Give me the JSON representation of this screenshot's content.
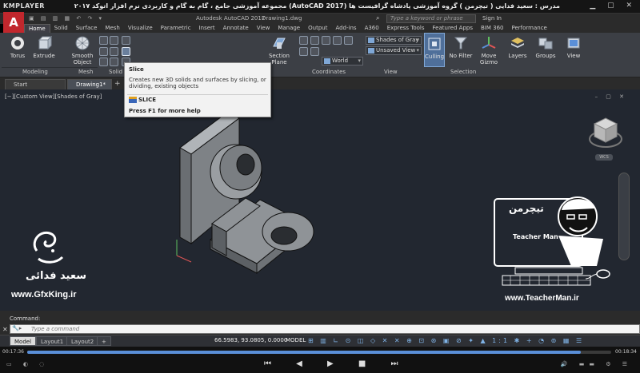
{
  "player": {
    "brand": "KMPLAYER",
    "title": "مجموعه آموزشی جامع ، گام به گام و کاربردی نرم افزار  اتوکد ۲۰۱۷ (AutoCAD 2017)   مدرس : سعید فدایی ( تیچرمن ) گروه آموزشی پادشاه گرافیست ها",
    "time_current": "00:17:36",
    "time_total": "00:18:34",
    "progress": 0.948
  },
  "acad": {
    "logo": "A",
    "app_name": "Autodesk AutoCAD 2017",
    "doc_name": "Drawing1.dwg",
    "search_placeholder": "Type a keyword or phrase",
    "sign_in": "Sign In"
  },
  "ribbon_tabs": [
    "Home",
    "Solid",
    "Surface",
    "Mesh",
    "Visualize",
    "Parametric",
    "Insert",
    "Annotate",
    "View",
    "Manage",
    "Output",
    "Add-ins",
    "A360",
    "Express Tools",
    "Featured Apps",
    "BIM 360",
    "Performance"
  ],
  "ribbon": {
    "torus": "Torus",
    "extrude": "Extrude",
    "smooth_object": "Smooth Object",
    "section_plane": "Section Plane",
    "culling": "Culling",
    "no_filter": "No Filter",
    "move_gizmo": "Move Gizmo",
    "layers": "Layers",
    "groups": "Groups",
    "view": "View",
    "visual_style": "Shades of Gray",
    "saved_view": "Unsaved View",
    "ucs": "World",
    "panels": {
      "modeling": "Modeling",
      "mesh": "Mesh",
      "solid": "Solid",
      "coordinates": "Coordinates",
      "view": "View",
      "selection": "Selection"
    }
  },
  "tooltip": {
    "title": "Slice",
    "description": "Creates new 3D solids and surfaces by slicing, or dividing, existing objects",
    "command": "SLICE",
    "help": "Press F1 for more help"
  },
  "file_tabs": [
    "Start",
    "Drawing1*"
  ],
  "viewport": {
    "label": "[−][Custom View][Shades of Gray]",
    "wcs": "WCS"
  },
  "watermarks": {
    "author_name": "سعید فدائی",
    "gfx_url": "www.GfxKing.ir",
    "teacher_url": "www.TeacherMan.ir",
    "teacher_logo_title": "تیچرمن",
    "teacher_logo_en": "Teacher Man"
  },
  "command": {
    "history": "Command:",
    "placeholder": "Type a command"
  },
  "layout_tabs": [
    "Model",
    "Layout1",
    "Layout2"
  ],
  "status": {
    "coords": "66.5983, 93.0805, 0.0000",
    "model": "MODEL"
  }
}
